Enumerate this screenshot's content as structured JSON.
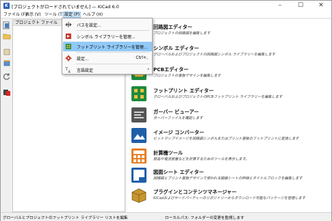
{
  "window": {
    "title": "[プロジェクトがロードされていません] — KiCad 6.0",
    "app_icon_letter": "K"
  },
  "menubar": {
    "items": [
      "ファイル (F)",
      "表示 (V)",
      "ツール (T)",
      "設定 (P)",
      "ヘルプ (H)"
    ],
    "active_index": 3
  },
  "tree": {
    "header": "プロジェクト ファイル"
  },
  "settings_menu": {
    "items": [
      {
        "label": "パスを設定...",
        "shortcut": "",
        "icon": "path-icon"
      },
      {
        "label": "シンボル ライブラリーを管理...",
        "shortcut": "",
        "icon": "symbol-library-icon"
      },
      {
        "label": "フットプリント ライブラリーを管理...",
        "shortcut": "",
        "icon": "footprint-library-icon",
        "highlighted": true
      },
      {
        "label": "設定...",
        "shortcut": "Ctrl+,",
        "icon": "preferences-gear-icon"
      },
      {
        "label": "言語設定",
        "shortcut": "",
        "icon": "language-icon",
        "submenu": true
      }
    ],
    "submenu_arrow": "›"
  },
  "launcher": {
    "entries": [
      {
        "title": "回路図エディター",
        "desc": "プロジェクトの回路図を編集します",
        "icon": "schematic-editor-icon",
        "color": "#c0392b"
      },
      {
        "title": "シンボル エディター",
        "desc": "グローバルおよびプロジェクトの回路図シンボル ライブラリーを編集します",
        "icon": "symbol-editor-icon",
        "color": "#c0392b"
      },
      {
        "title": "PCBエディター",
        "desc": "プロジェクトの基板デザインを編集します",
        "icon": "pcb-editor-icon",
        "color": "#1e8a3c"
      },
      {
        "title": "フットプリント エディター",
        "desc": "グローバルおよびプロジェクトのPCBフットプリント ライブラリーを編集します",
        "icon": "footprint-editor-icon",
        "color": "#1e8a3c"
      },
      {
        "title": "ガーバー ビューアー",
        "desc": "ガーバーファイルを確認します",
        "icon": "gerber-viewer-icon",
        "color": "#555555"
      },
      {
        "title": "イメージ コンバーター",
        "desc": "ビットマップイメージを回路図シンボルまたはプリント基板のフットプリントに変換します",
        "icon": "image-converter-icon",
        "color": "#1f5fa8"
      },
      {
        "title": "計算機ツール",
        "desc": "部品や電流容量などを計算するためのツールを表示します。",
        "icon": "calculator-icon",
        "color": "#e67e22"
      },
      {
        "title": "図面シート エディター",
        "desc": "回路図とプリント基板デザインで使われる図面シートの枠線とタイトルブロックを編集します",
        "icon": "drawing-sheet-editor-icon",
        "color": "#1f5fa8"
      },
      {
        "title": "プラグインとコンテンツマネージャー",
        "desc": "KiCadおよびサードパーティーのリポジトリーからダウンロード可能なパッケージを管理します",
        "icon": "plugin-content-manager-icon",
        "color": "#c8962f"
      }
    ]
  },
  "statusbar": {
    "left": "グローバルとプロジェクトのフットプリント ライブラリー リストを編集",
    "right": "ローカルパス: フォルダーの変更を監視します"
  },
  "colors": {
    "menu_highlight": "#91c9f7",
    "menubar_active": "#cce4f7"
  }
}
